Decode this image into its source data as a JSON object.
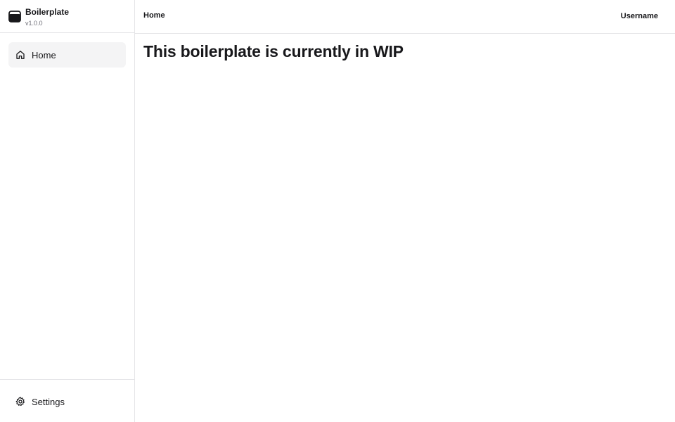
{
  "brand": {
    "name": "Boilerplate",
    "version": "v1.0.0",
    "icon": "app-window-icon"
  },
  "sidebar": {
    "items": [
      {
        "label": "Home",
        "icon": "home-icon",
        "active": true
      }
    ],
    "footer": {
      "label": "Settings",
      "icon": "gear-icon"
    }
  },
  "header": {
    "breadcrumb": "Home",
    "username": "Username"
  },
  "main": {
    "title": "This boilerplate is currently in WIP"
  },
  "colors": {
    "border": "#e4e4e7",
    "active_bg": "#f4f4f5",
    "text": "#18181b",
    "muted": "#71717a"
  }
}
